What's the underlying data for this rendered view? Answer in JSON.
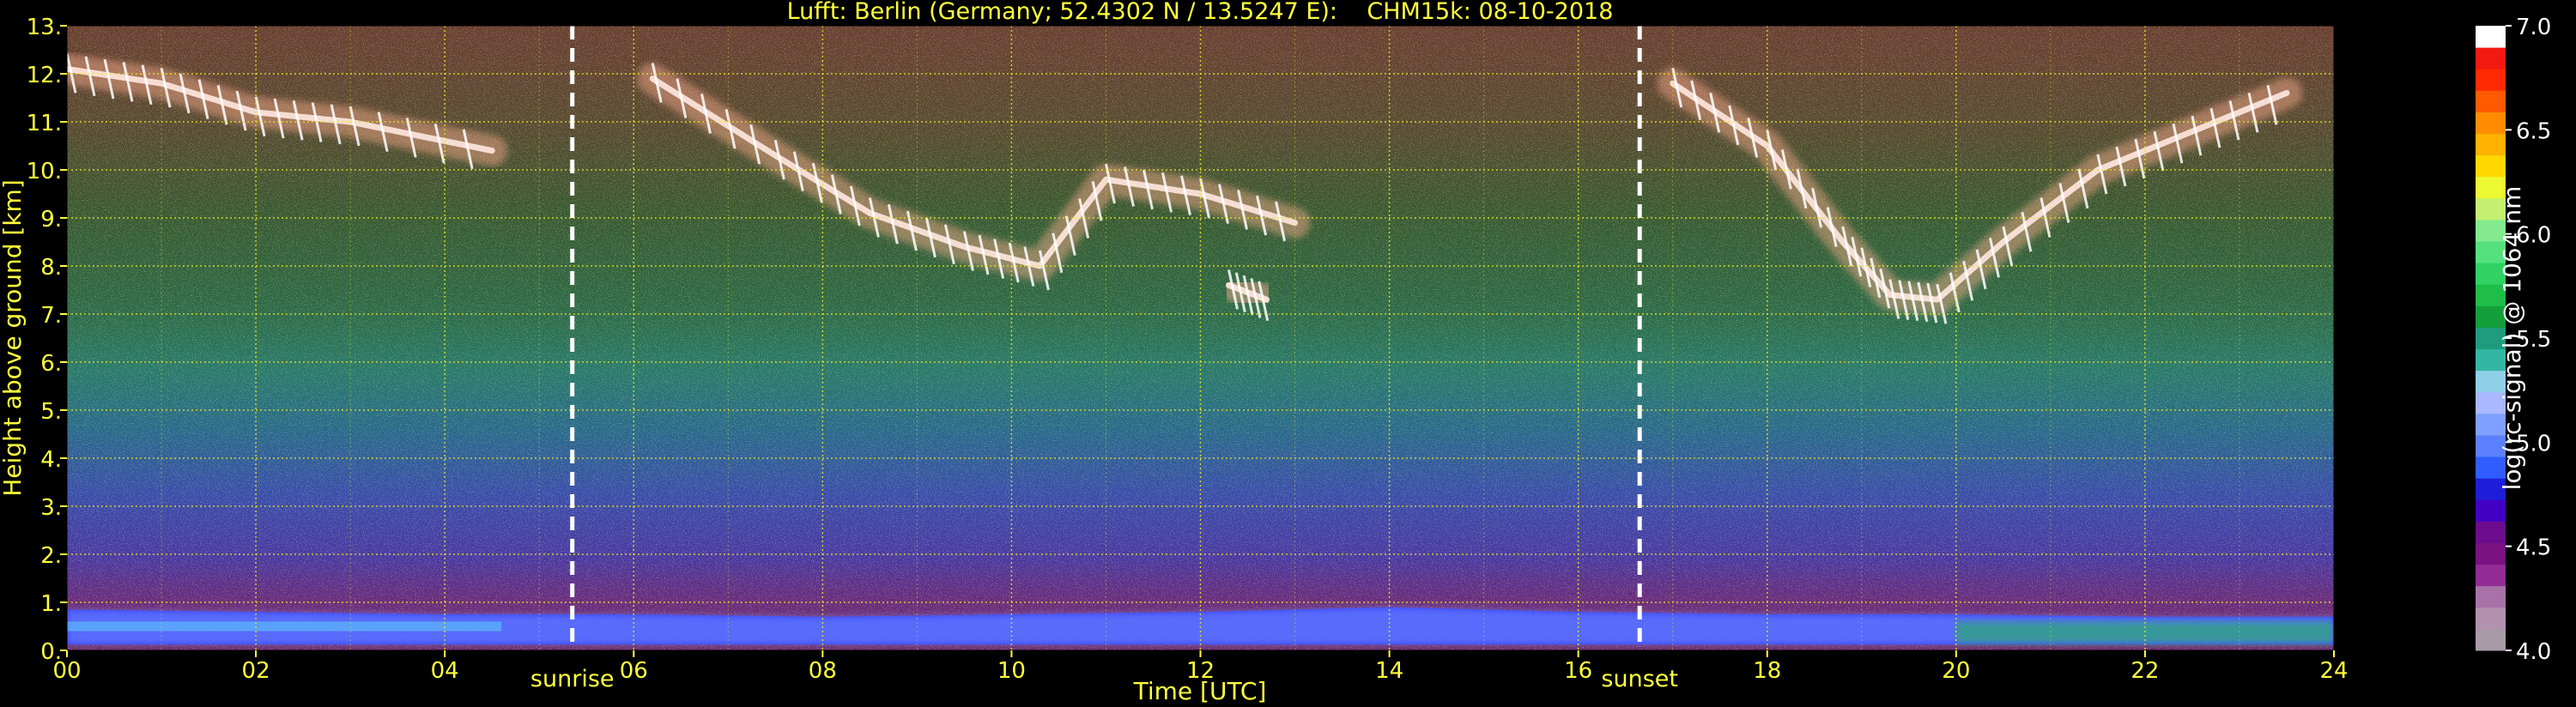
{
  "chart_data": {
    "type": "heatmap",
    "title": "Lufft: Berlin (Germany; 52.4302 N / 13.5247 E):    CHM15k: 08-10-2018",
    "xlabel": "Time [UTC]",
    "ylabel": "Height above ground [km]",
    "xlim": [
      0,
      24
    ],
    "ylim": [
      0,
      13
    ],
    "x_ticks": [
      "00",
      "02",
      "04",
      "06",
      "08",
      "10",
      "12",
      "14",
      "16",
      "18",
      "20",
      "22",
      "24"
    ],
    "y_ticks": [
      "0.",
      "1.",
      "2.",
      "3.",
      "4.",
      "5.",
      "6.",
      "7.",
      "8.",
      "9.",
      "10.",
      "11.",
      "12.",
      "13."
    ],
    "grid": true,
    "colorbar": {
      "label": "log(rc-signal) @ 1064 nm",
      "range": [
        4.0,
        7.0
      ],
      "ticks": [
        "4.0",
        "4.5",
        "5.0",
        "5.5",
        "6.0",
        "6.5",
        "7.0"
      ],
      "colors": [
        "#a99aa8",
        "#b190b0",
        "#a772a8",
        "#932b95",
        "#7a1282",
        "#6b0d8c",
        "#4200c4",
        "#1e1ed8",
        "#2f5dff",
        "#5a80ff",
        "#7fa0ff",
        "#a9b8ff",
        "#8fd0e8",
        "#33b6a3",
        "#1f9c7d",
        "#13a03b",
        "#1fbd4a",
        "#30d263",
        "#55e07e",
        "#82ea8d",
        "#c3f070",
        "#ecf832",
        "#ffd800",
        "#ffb200",
        "#ff8c00",
        "#ff5a00",
        "#ff2a00",
        "#f21a10",
        "#ffffff"
      ]
    },
    "markers": [
      {
        "label": "sunrise",
        "x": 5.35
      },
      {
        "label": "sunset",
        "x": 16.65
      }
    ],
    "cloud_layers": [
      {
        "x": [
          0.0,
          1.0,
          2.0,
          3.0,
          4.5
        ],
        "y": [
          12.1,
          11.8,
          11.2,
          11.0,
          10.4
        ]
      },
      {
        "x": [
          6.2,
          7.5,
          8.5,
          9.5,
          10.3,
          11.0,
          12.0,
          13.0
        ],
        "y": [
          11.9,
          10.3,
          9.1,
          8.4,
          8.0,
          9.8,
          9.5,
          8.9
        ]
      },
      {
        "x": [
          12.3,
          12.7
        ],
        "y": [
          7.6,
          7.3
        ]
      },
      {
        "x": [
          17.0,
          18.0,
          18.8,
          19.3,
          19.8,
          20.5,
          21.5,
          22.5,
          23.5
        ],
        "y": [
          11.8,
          10.5,
          8.5,
          7.4,
          7.3,
          8.5,
          10.0,
          10.8,
          11.6
        ]
      }
    ],
    "boundary_layer": {
      "x": [
        0,
        2,
        4,
        6,
        8,
        10,
        12,
        14,
        16,
        18,
        20,
        22,
        24
      ],
      "top_km": [
        0.85,
        0.8,
        0.75,
        0.75,
        0.7,
        0.75,
        0.8,
        0.9,
        0.8,
        0.75,
        0.75,
        0.7,
        0.7
      ]
    }
  }
}
